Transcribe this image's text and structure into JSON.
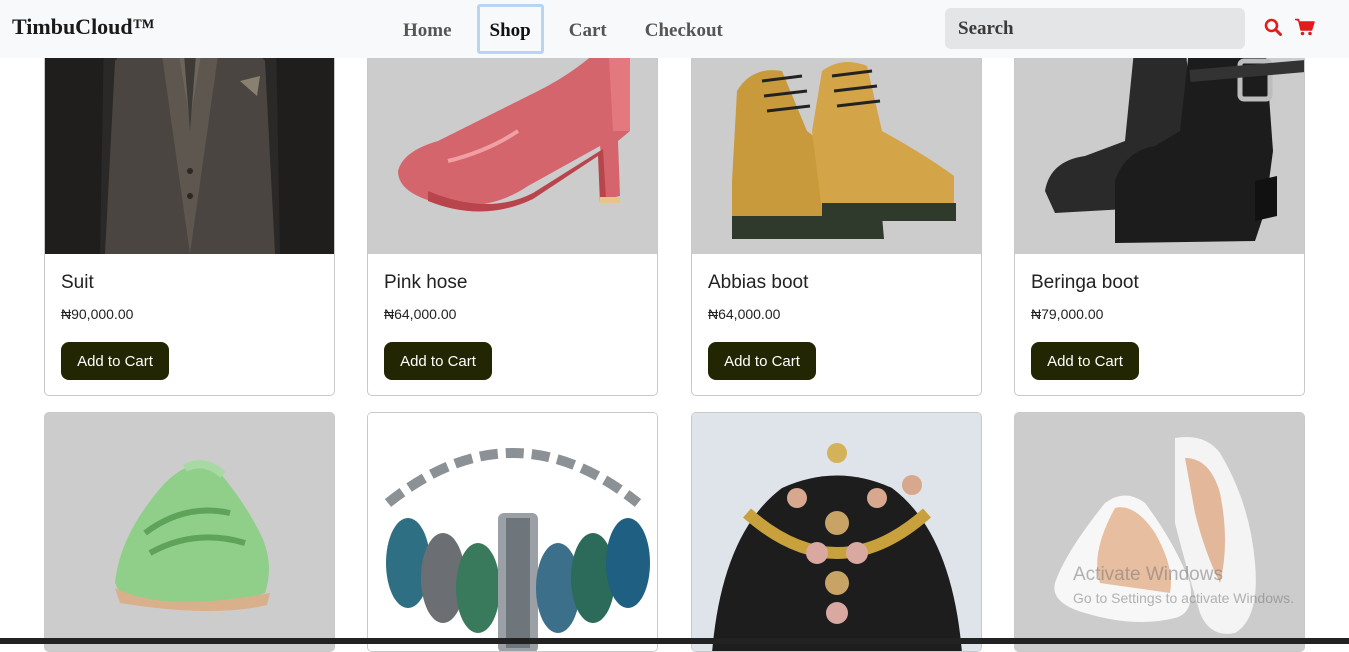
{
  "brand": "TimbuCloud™",
  "nav": [
    {
      "label": "Home",
      "active": false
    },
    {
      "label": "Shop",
      "active": true
    },
    {
      "label": "Cart",
      "active": false
    },
    {
      "label": "Checkout",
      "active": false
    }
  ],
  "search": {
    "placeholder": "Search",
    "value": ""
  },
  "icons": {
    "search": "search-icon",
    "cart": "cart-icon",
    "accent": "#e31b1b"
  },
  "products": [
    {
      "name": "Suit",
      "price": "₦90,000.00",
      "button": "Add to Cart",
      "image": "suit"
    },
    {
      "name": "Pink hose",
      "price": "₦64,000.00",
      "button": "Add to Cart",
      "image": "pink-heel"
    },
    {
      "name": "Abbias boot",
      "price": "₦64,000.00",
      "button": "Add to Cart",
      "image": "tan-boot"
    },
    {
      "name": "Beringa boot",
      "price": "₦79,000.00",
      "button": "Add to Cart",
      "image": "black-boot"
    },
    {
      "name": "",
      "price": "",
      "button": "",
      "image": "green-sneaker"
    },
    {
      "name": "",
      "price": "",
      "button": "",
      "image": "chain-bracelet"
    },
    {
      "name": "",
      "price": "",
      "button": "",
      "image": "jewelry-set"
    },
    {
      "name": "",
      "price": "",
      "button": "",
      "image": "white-flat"
    }
  ],
  "watermark": {
    "line1": "Activate Windows",
    "line2": "Go to Settings to activate Windows."
  },
  "colors": {
    "button": "#222602",
    "image_bg": "#cccccc",
    "navbar": "#f8f9fa"
  }
}
